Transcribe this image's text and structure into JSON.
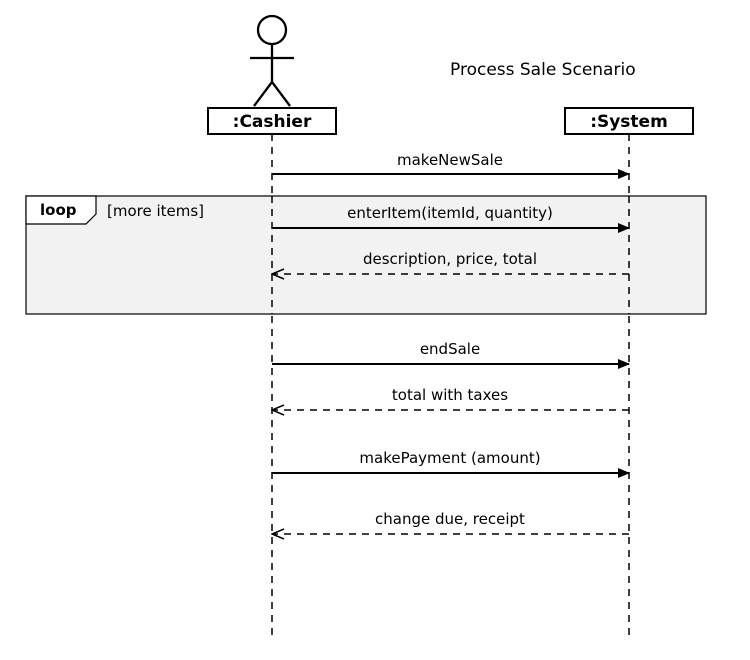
{
  "title": "Process Sale Scenario",
  "actor": {
    "label": ":Cashier"
  },
  "system": {
    "label": ":System"
  },
  "loop": {
    "keyword": "loop",
    "guard": "[more items]"
  },
  "messages": {
    "m1": "makeNewSale",
    "m2": "enterItem(itemId, quantity)",
    "m3": "description, price, total",
    "m4": "endSale",
    "m5": "total with taxes",
    "m6": "makePayment (amount)",
    "m7": "change due, receipt"
  }
}
